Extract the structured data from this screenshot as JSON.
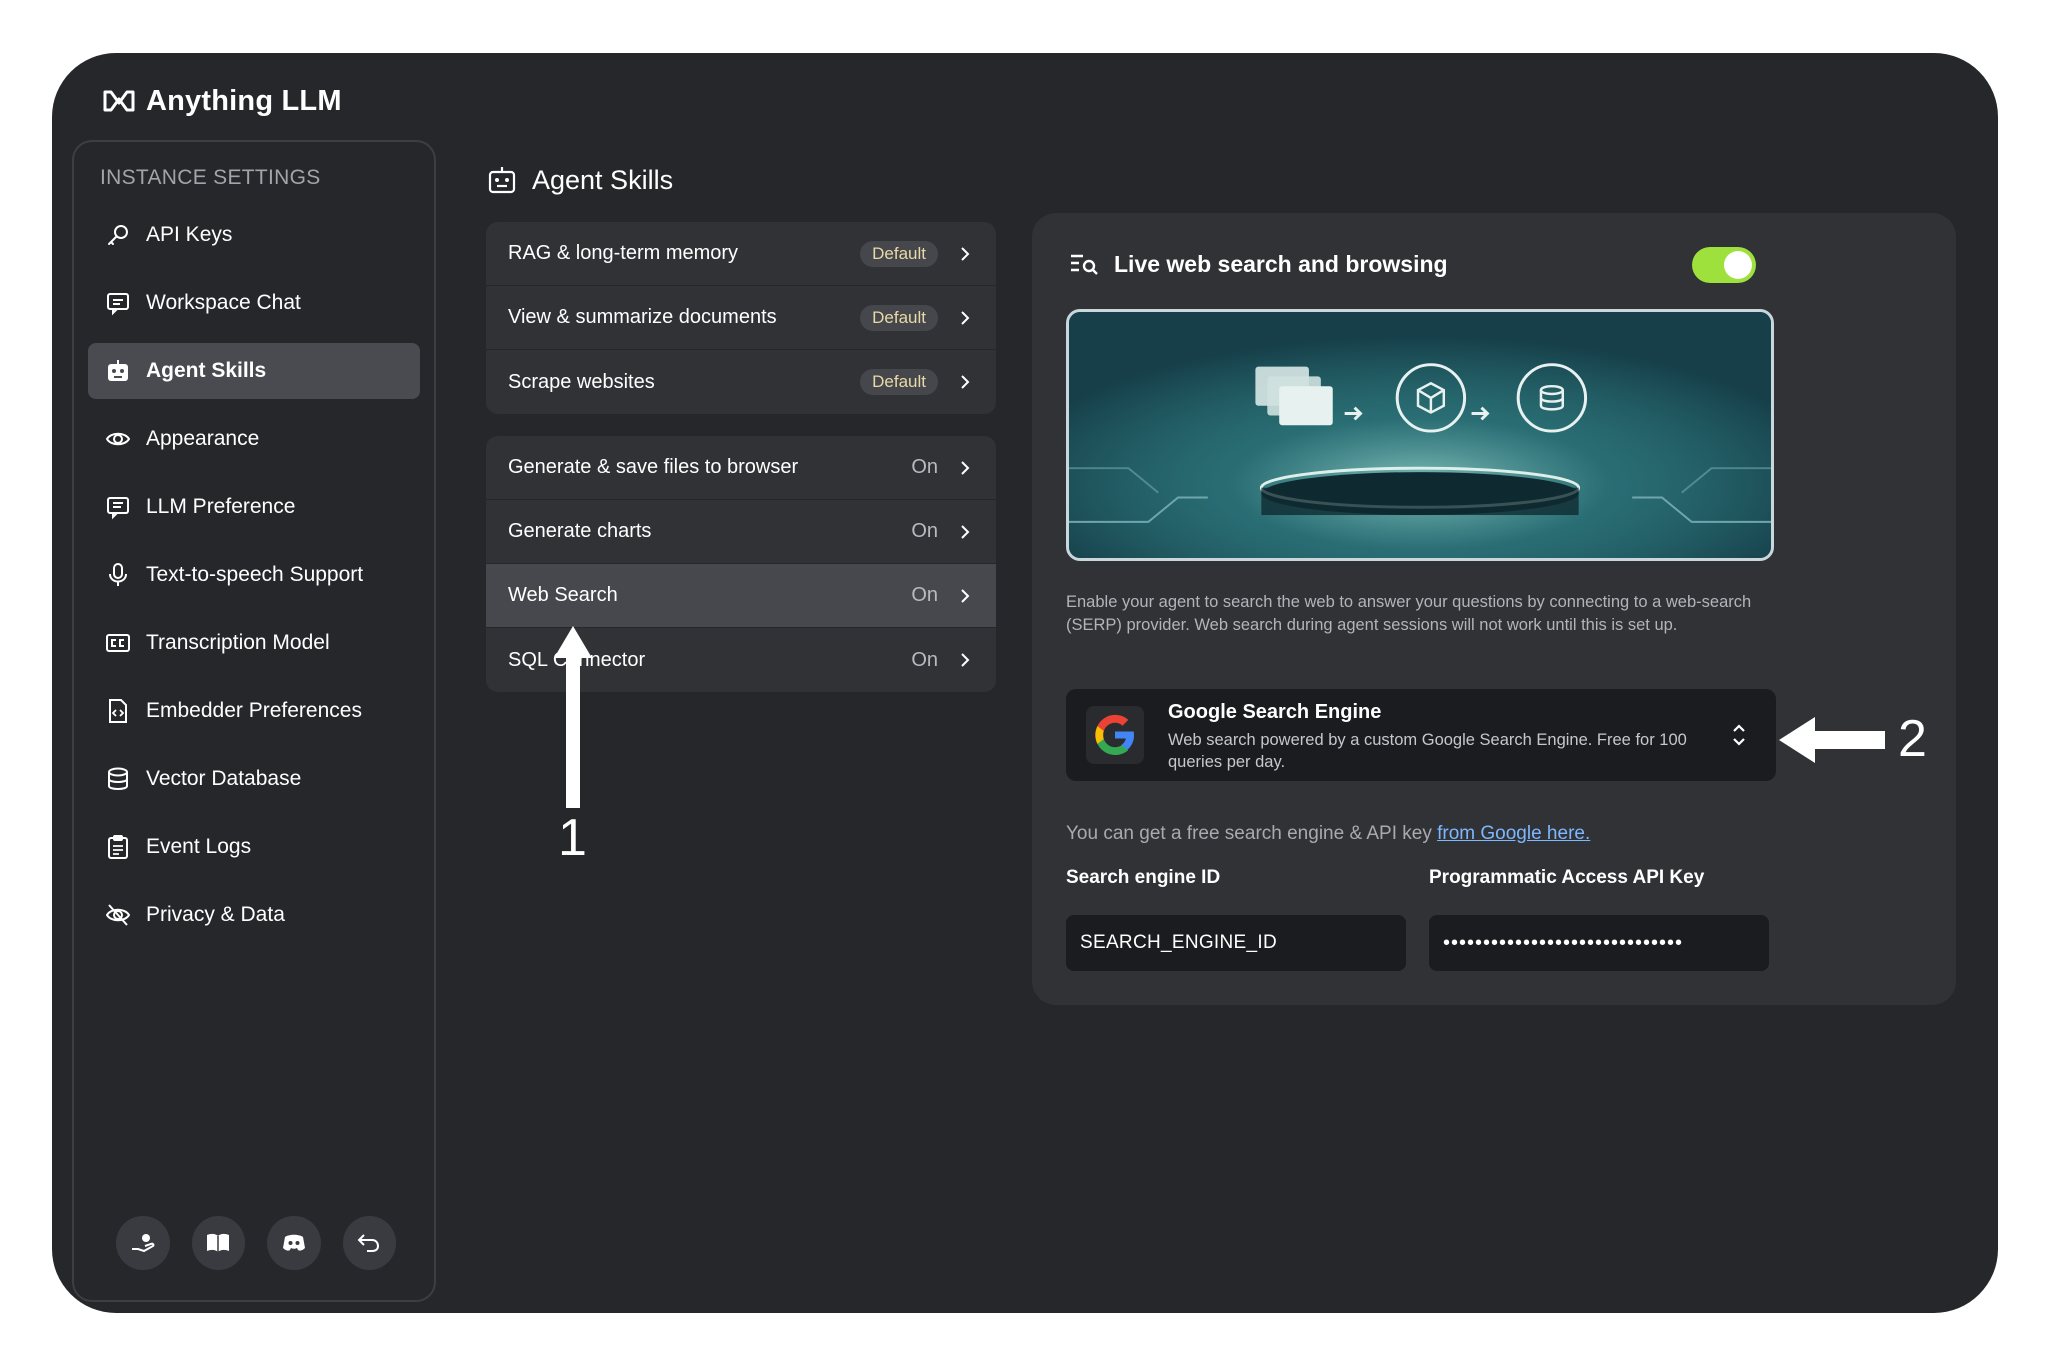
{
  "app": {
    "title": "Anything LLM"
  },
  "sidebar": {
    "heading": "INSTANCE SETTINGS",
    "items": [
      {
        "label": "API Keys",
        "icon": "key-icon"
      },
      {
        "label": "Workspace Chat",
        "icon": "chat-icon"
      },
      {
        "label": "Agent Skills",
        "icon": "robot-icon",
        "active": true
      },
      {
        "label": "Appearance",
        "icon": "eye-icon"
      },
      {
        "label": "LLM Preference",
        "icon": "chat-text-icon"
      },
      {
        "label": "Text-to-speech Support",
        "icon": "microphone-icon"
      },
      {
        "label": "Transcription Model",
        "icon": "closed-caption-icon"
      },
      {
        "label": "Embedder Preferences",
        "icon": "file-code-icon"
      },
      {
        "label": "Vector Database",
        "icon": "database-icon"
      },
      {
        "label": "Event Logs",
        "icon": "clipboard-icon"
      },
      {
        "label": "Privacy & Data",
        "icon": "eye-slash-icon"
      }
    ],
    "footer": [
      "support-icon",
      "book-icon",
      "discord-icon",
      "back-arrow-icon"
    ]
  },
  "page": {
    "title": "Agent Skills"
  },
  "skills": {
    "default_group": [
      {
        "label": "RAG & long-term memory",
        "badge": "Default"
      },
      {
        "label": "View & summarize documents",
        "badge": "Default"
      },
      {
        "label": "Scrape websites",
        "badge": "Default"
      }
    ],
    "configurable_group": [
      {
        "label": "Generate & save files to browser",
        "status": "On"
      },
      {
        "label": "Generate charts",
        "status": "On"
      },
      {
        "label": "Web Search",
        "status": "On",
        "selected": true
      },
      {
        "label": "SQL Connector",
        "status": "On"
      }
    ]
  },
  "detail": {
    "title": "Live web search and browsing",
    "enabled": true,
    "description": "Enable your agent to search the web to answer your questions by connecting to a web-search (SERP) provider. Web search during agent sessions will not work until this is set up.",
    "provider": {
      "name": "Google Search Engine",
      "description": "Web search powered by a custom Google Search Engine. Free for 100 queries per day."
    },
    "api_note": "You can get a free search engine & API key ",
    "api_link": "from Google here.",
    "fields": {
      "search_engine_label": "Search engine ID",
      "search_engine_value": "SEARCH_ENGINE_ID",
      "api_key_label": "Programmatic Access API Key",
      "api_key_value": "••••••••••••••••••••••••••••••"
    }
  },
  "annotations": {
    "one": "1",
    "two": "2"
  },
  "colors": {
    "frame": "#26272b",
    "panel": "#313236",
    "toggle_on": "#9ee03c",
    "link": "#7cb7ff",
    "badge_text": "#e8d9a7"
  }
}
